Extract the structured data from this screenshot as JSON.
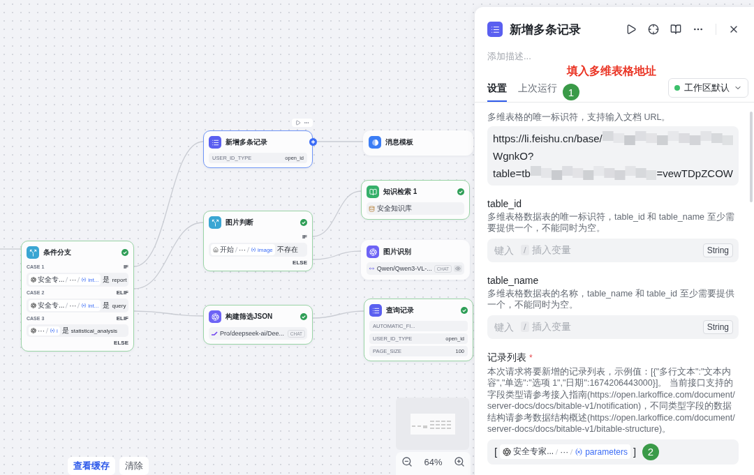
{
  "canvas": {
    "nodes": [
      {
        "title": "条件分支",
        "completed": true,
        "selected": false,
        "rows": [
          {
            "kind": "case_header",
            "case": "CASE 1",
            "branch": "IF"
          },
          {
            "kind": "condition",
            "path": [
              "安全专...",
              "···",
              "int..."
            ],
            "operator": "是",
            "value": "report"
          },
          {
            "kind": "case_header",
            "case": "CASE 2",
            "branch": "ELIF"
          },
          {
            "kind": "condition",
            "path": [
              "安全专...",
              "···",
              "int..."
            ],
            "operator": "是",
            "value": "query"
          },
          {
            "kind": "case_header",
            "case": "CASE 3",
            "branch": "ELIF"
          },
          {
            "kind": "condition",
            "path": [
              "···",
              "i"
            ],
            "operator": "是",
            "value": "statistical_analysis"
          },
          {
            "kind": "case_header",
            "branch": "ELSE"
          }
        ]
      },
      {
        "title": "新增多条记录",
        "completed": false,
        "selected": true,
        "rows": [
          {
            "kind": "param",
            "key": "USER_ID_TYPE",
            "value": "open_id"
          }
        ]
      },
      {
        "title": "消息模板",
        "completed": false,
        "selected": false
      },
      {
        "title": "知识检索 1",
        "completed": true,
        "selected": false,
        "rows": [
          {
            "kind": "knowledge",
            "text": "安全知识库"
          }
        ]
      },
      {
        "title": "图片判断",
        "completed": true,
        "selected": false,
        "rows": [
          {
            "kind": "case_header",
            "branch": "IF"
          },
          {
            "kind": "condition",
            "path": [
              "开始",
              "···",
              "image"
            ],
            "operator": "不存在"
          },
          {
            "kind": "case_header",
            "branch": "ELSE"
          }
        ]
      },
      {
        "title": "图片识别",
        "completed": false,
        "selected": false,
        "rows": [
          {
            "kind": "model",
            "text": "Qwen/Qwen3-VL-...",
            "tag": "CHAT",
            "vision": true
          }
        ]
      },
      {
        "title": "构建筛选JSON",
        "completed": true,
        "selected": false,
        "rows": [
          {
            "kind": "model",
            "text": "Pro/deepseek-ai/Dee...",
            "tag": "CHAT",
            "vision": false
          }
        ]
      },
      {
        "title": "查询记录",
        "completed": true,
        "selected": false,
        "rows": [
          {
            "kind": "param",
            "key": "AUTOMATIC_FI..."
          },
          {
            "kind": "param",
            "key": "USER_ID_TYPE",
            "value": "open_id"
          },
          {
            "kind": "param",
            "key": "PAGE_SIZE",
            "value": "100"
          }
        ]
      }
    ]
  },
  "cache_actions": [
    {
      "kind": "primary",
      "label": "查看缓存"
    },
    {
      "kind": "plain",
      "label": "清除"
    }
  ],
  "zoom": {
    "reading": "64%"
  },
  "panel": {
    "title": "新增多条记录",
    "description_placeholder": "添加描述...",
    "tabs": [
      {
        "label": "设置",
        "selected": true
      },
      {
        "label": "上次运行",
        "selected": false
      }
    ],
    "callout": {
      "text": "填入多维表格地址",
      "badge": "1"
    },
    "scope": {
      "label": "工作区默认"
    },
    "fields": [
      {
        "kind": "url",
        "description": "多维表格的唯一标识符，支持输入文档 URL。",
        "lines": [
          [
            {
              "kind": "text",
              "text": "https://li.feishu.cn/base/"
            },
            {
              "kind": "redacted"
            }
          ],
          [
            {
              "kind": "text",
              "text": "WgnkO?"
            }
          ],
          [
            {
              "kind": "text",
              "text": "table=tb"
            },
            {
              "kind": "redacted"
            },
            {
              "kind": "text",
              "text": "=vewTDpZCOW"
            }
          ]
        ]
      },
      {
        "kind": "input",
        "label": "table_id",
        "description": "多维表格数据表的唯一标识符，table_id 和 table_name 至少需要提供一个，不能同时为空。",
        "placeholder": "键入",
        "shortcut": "/",
        "shortcut_hint": "插入变量",
        "type": "String"
      },
      {
        "kind": "input",
        "label": "table_name",
        "description": "多维表格数据表的名称，table_name 和 table_id 至少需要提供一个，不能同时为空。",
        "placeholder": "键入",
        "shortcut": "/",
        "shortcut_hint": "插入变量",
        "type": "String"
      },
      {
        "kind": "reference",
        "label": "记录列表",
        "required_mark": "*",
        "description": "本次请求将要新增的记录列表，示例值：[{\"多行文本\":\"文本内容\",\"单选\":\"选项 1\",\"日期\":1674206443000}]。 当前接口支持的字段类型请参考接入指南(https://open.larkoffice.com/document/server-docs/docs/bitable-v1/notification)，不同类型字段的数据结构请参考数据结构概述(https://open.larkoffice.com/document/server-docs/docs/bitable-v1/bitable-structure)。",
        "open": "[",
        "ref": {
          "path": [
            "安全专家...",
            "···",
            "parameters"
          ]
        },
        "close": "]",
        "badge": "2"
      }
    ]
  }
}
